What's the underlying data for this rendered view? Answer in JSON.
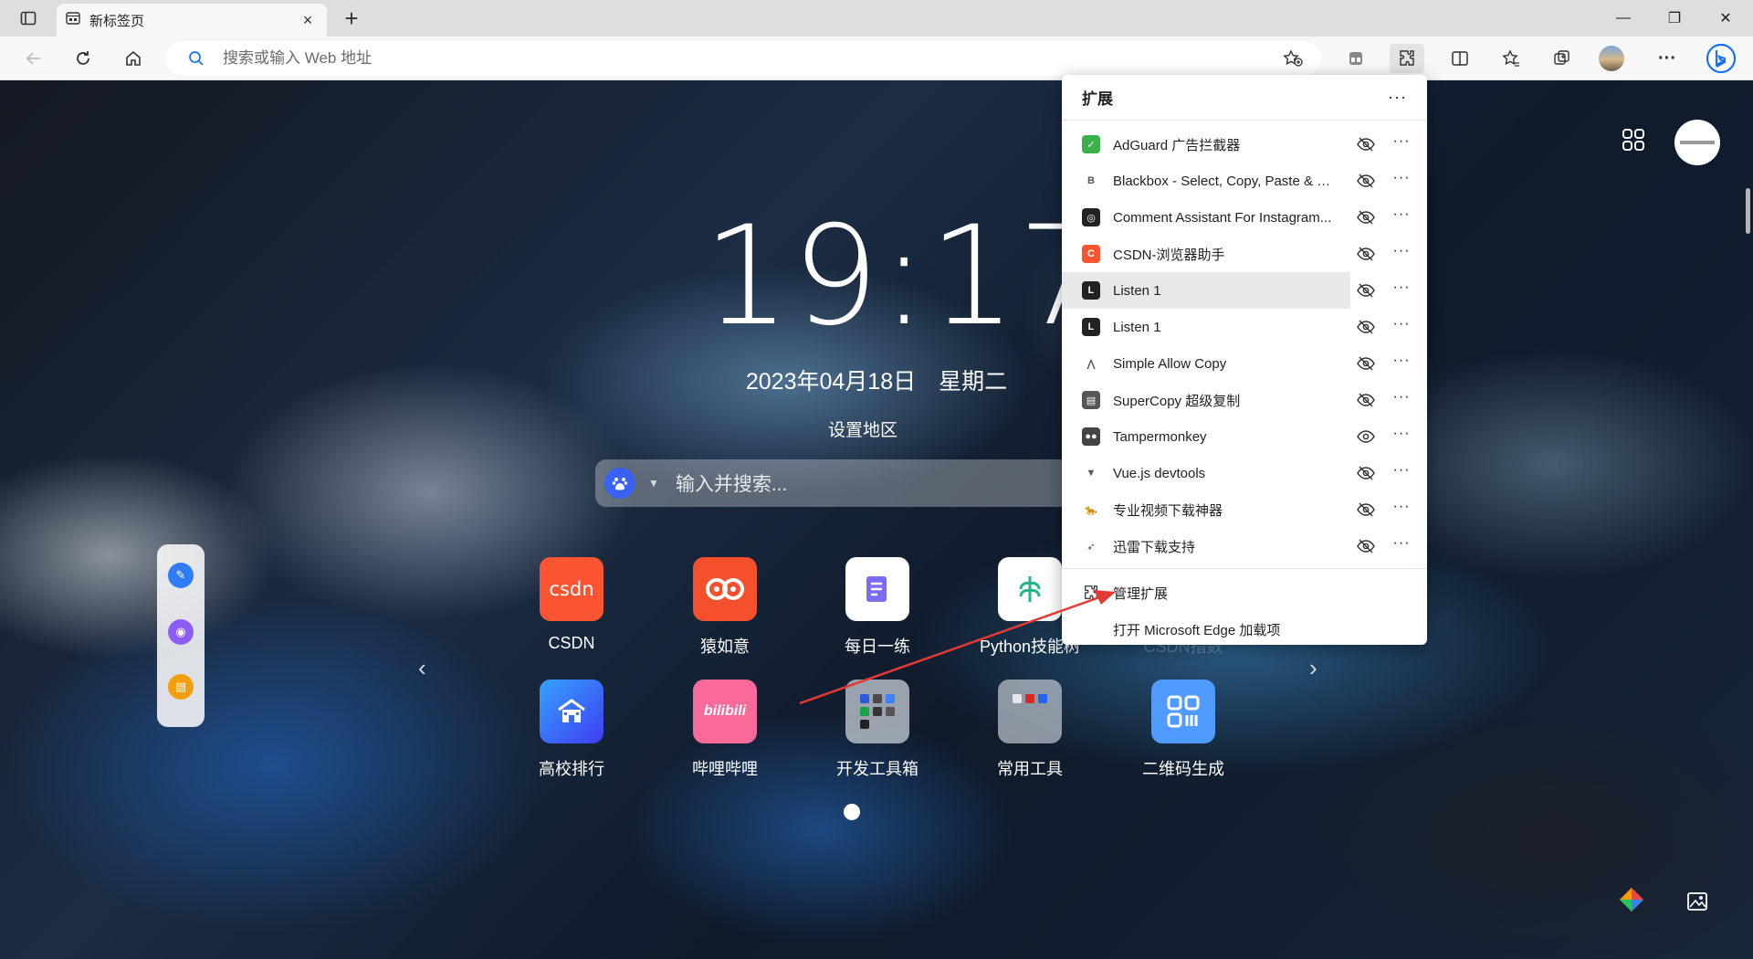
{
  "browser": {
    "tab": {
      "title": "新标签页",
      "close": "×"
    },
    "new_tab": "+",
    "window": {
      "minimize": "—",
      "restore": "❐",
      "close": "✕"
    }
  },
  "toolbar": {
    "address_placeholder": "搜索或输入 Web 地址"
  },
  "newtab": {
    "time": "19:17",
    "date": "2023年04月18日　星期二",
    "region": "设置地区",
    "search_placeholder": "输入并搜索...",
    "apps_row1": [
      {
        "label": "CSDN",
        "icon_text": "CSDN",
        "color": "#fc5531"
      },
      {
        "label": "猿如意",
        "icon_text": "ᘓ",
        "color": "#f4502c"
      },
      {
        "label": "每日一练",
        "icon_text": "✎",
        "color": "#ffffff"
      },
      {
        "label": "Python技能树",
        "icon_text": "❦",
        "color": "#ffffff"
      },
      {
        "label": "CSDN指数",
        "icon_text": "",
        "color": "#3a8dff"
      }
    ],
    "apps_row2": [
      {
        "label": "高校排行",
        "icon_text": "⌂",
        "color": "#2d6df6"
      },
      {
        "label": "哔哩哔哩",
        "icon_text": "bilibili",
        "color": "#f86a9a"
      },
      {
        "label": "开发工具箱",
        "icon_text": "▦",
        "color": "#c8d0d8"
      },
      {
        "label": "常用工具",
        "icon_text": "▦",
        "color": "#b7bfc8"
      },
      {
        "label": "二维码生成",
        "icon_text": "▣",
        "color": "#4f9bff"
      }
    ]
  },
  "extensions_panel": {
    "title": "扩展",
    "more": "···",
    "items": [
      {
        "name": "AdGuard 广告拦截器",
        "icon": "adguard-icon",
        "color": "#3bb14a",
        "glyph": "✓",
        "pinned": false
      },
      {
        "name": "Blackbox - Select, Copy, Paste & S...",
        "icon": "blackbox-icon",
        "color": "#ffffff",
        "glyph": "B",
        "pinned": false
      },
      {
        "name": "Comment Assistant For Instagram...",
        "icon": "comment-assistant-icon",
        "color": "#222222",
        "glyph": "◎",
        "pinned": false
      },
      {
        "name": "CSDN-浏览器助手",
        "icon": "csdn-helper-icon",
        "color": "#fc5531",
        "glyph": "C",
        "pinned": false
      },
      {
        "name": "Listen 1",
        "icon": "listen1-icon",
        "color": "#222222",
        "glyph": "L",
        "pinned": false
      },
      {
        "name": "Listen 1",
        "icon": "listen1-icon",
        "color": "#222222",
        "glyph": "L",
        "pinned": false
      },
      {
        "name": "Simple Allow Copy",
        "icon": "simple-allow-copy-icon",
        "color": "#ffffff",
        "glyph": "⋀",
        "pinned": false
      },
      {
        "name": "SuperCopy 超级复制",
        "icon": "supercopy-icon",
        "color": "#555555",
        "glyph": "▤",
        "pinned": false
      },
      {
        "name": "Tampermonkey",
        "icon": "tampermonkey-icon",
        "color": "#444444",
        "glyph": "●●",
        "pinned": true
      },
      {
        "name": "Vue.js devtools",
        "icon": "vue-devtools-icon",
        "color": "#ffffff",
        "glyph": "▼",
        "pinned": false
      },
      {
        "name": "专业视频下载神器",
        "icon": "video-downloader-icon",
        "color": "#ffffff",
        "glyph": "🐆",
        "pinned": false
      },
      {
        "name": "迅雷下载支持",
        "icon": "xunlei-icon",
        "color": "#ffffff",
        "glyph": "➶",
        "pinned": false
      }
    ],
    "manage": "管理扩展",
    "open_addons": "打开 Microsoft Edge 加载项",
    "dots": "···"
  },
  "colors": {
    "accent": "#0078d4",
    "annotation_arrow": "#e53935"
  }
}
